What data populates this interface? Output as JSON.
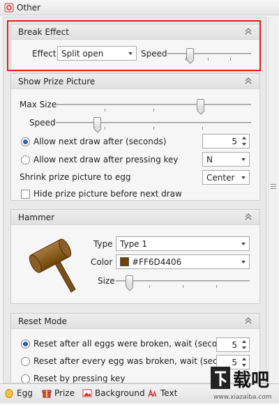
{
  "window": {
    "title": "Other"
  },
  "break_effect": {
    "title": "Break Effect",
    "effect_label": "Effect",
    "effect_value": "Split open",
    "speed_label": "Speed",
    "speed_level": 0.25
  },
  "prize_picture": {
    "title": "Show Prize Picture",
    "max_size_label": "Max Size",
    "max_size_level": 0.75,
    "speed_label": "Speed",
    "speed_level": 0.2,
    "radio_after_seconds": "Allow next draw after (seconds)",
    "seconds_value": "5",
    "radio_after_key": "Allow next draw after pressing key",
    "key_value": "N",
    "shrink_label": "Shrink prize picture to egg",
    "shrink_value": "Center",
    "hide_label": "Hide prize picture before next draw"
  },
  "hammer": {
    "title": "Hammer",
    "type_label": "Type",
    "type_value": "Type 1",
    "color_label": "Color",
    "color_value": "#FF6D4406",
    "color_hex": "#6D4406",
    "size_label": "Size",
    "size_level": 0.08
  },
  "reset_mode": {
    "title": "Reset Mode",
    "radio_all_broken": "Reset after all eggs were broken, wait (seconds)",
    "all_broken_value": "5",
    "radio_every_broken": "Reset after every egg was broken, wait (seconds)",
    "every_broken_value": "5",
    "radio_key": "Reset by pressing key"
  },
  "tabs": [
    {
      "label": "Egg",
      "icon": "egg-icon"
    },
    {
      "label": "Prize",
      "icon": "prize-icon"
    },
    {
      "label": "Background",
      "icon": "background-image-icon"
    },
    {
      "label": "Text",
      "icon": "text-icon"
    }
  ],
  "watermark": {
    "brand": "下载吧",
    "url": "www.xiazaiba.com"
  },
  "colors": {
    "highlight": "#E41B1B",
    "accent": "#2F5FBF"
  }
}
